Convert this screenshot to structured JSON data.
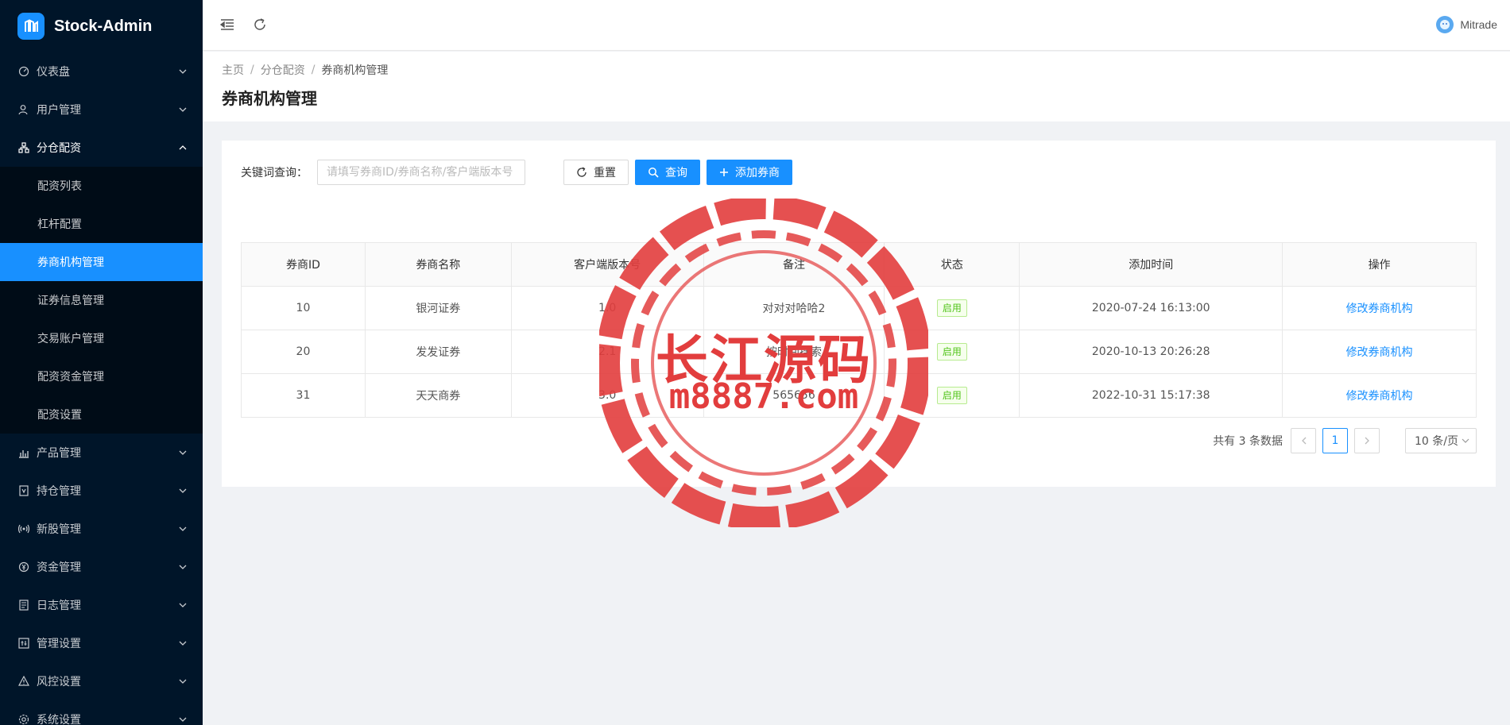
{
  "app": {
    "title": "Stock-Admin"
  },
  "sidebar": {
    "menu": [
      {
        "label": "仪表盘",
        "icon": "dashboard-icon"
      },
      {
        "label": "用户管理",
        "icon": "user-icon"
      },
      {
        "label": "分仓配资",
        "icon": "cluster-icon",
        "open": true,
        "children": [
          "配资列表",
          "杠杆配置",
          "券商机构管理",
          "证券信息管理",
          "交易账户管理",
          "配资资金管理",
          "配资设置"
        ],
        "active_child": "券商机构管理"
      },
      {
        "label": "产品管理",
        "icon": "bar-chart-icon"
      },
      {
        "label": "持仓管理",
        "icon": "position-icon"
      },
      {
        "label": "新股管理",
        "icon": "signal-icon"
      },
      {
        "label": "资金管理",
        "icon": "money-icon"
      },
      {
        "label": "日志管理",
        "icon": "log-icon"
      },
      {
        "label": "管理设置",
        "icon": "control-icon"
      },
      {
        "label": "风控设置",
        "icon": "warning-icon"
      },
      {
        "label": "系统设置",
        "icon": "setting-icon"
      }
    ]
  },
  "header": {
    "user_name": "Mitrade"
  },
  "breadcrumb": [
    "主页",
    "分仓配资",
    "券商机构管理"
  ],
  "page_title": "券商机构管理",
  "filter": {
    "label": "关键词查询：",
    "placeholder": "请填写券商ID/券商名称/客户端版本号",
    "reset_label": "重置",
    "search_label": "查询",
    "add_label": "添加券商"
  },
  "table": {
    "columns": [
      "券商ID",
      "券商名称",
      "客户端版本号",
      "备注",
      "状态",
      "添加时间",
      "操作"
    ],
    "rows": [
      {
        "id": "10",
        "name": "银河证券",
        "version": "1.0",
        "remark": "对对对哈哈2",
        "status": "启用",
        "time": "2020-07-24 16:13:00",
        "action": "修改券商机构"
      },
      {
        "id": "20",
        "name": "发发证券",
        "version": "2.1",
        "remark": "按时间搜索",
        "status": "启用",
        "time": "2020-10-13 20:26:28",
        "action": "修改券商机构"
      },
      {
        "id": "31",
        "name": "天天商券",
        "version": "3.0",
        "remark": "565656",
        "status": "启用",
        "time": "2022-10-31 15:17:38",
        "action": "修改券商机构"
      }
    ]
  },
  "pagination": {
    "total_text": "共有 3 条数据",
    "current": "1",
    "page_size": "10 条/页"
  },
  "watermark": {
    "cn": "长江源码",
    "url": "m8887.com"
  },
  "colors": {
    "primary": "#1890ff",
    "sidebar": "#001529",
    "success": "#52c41a",
    "watermark": "#e23d3d"
  }
}
